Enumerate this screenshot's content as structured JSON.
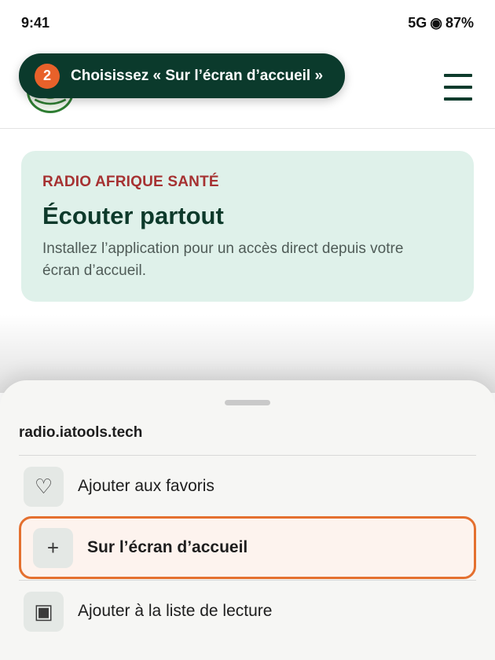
{
  "status_bar": {
    "time": "9:41",
    "network": "5G",
    "signal_glyph": "◉",
    "battery": "87%"
  },
  "header": {
    "logo_icon": "radio-afrique-sante-logo",
    "menu_icon": "hamburger-icon"
  },
  "tooltip": {
    "step_number": "2",
    "text": "Choisissez « Sur l’écran d’accueil »"
  },
  "promo": {
    "eyebrow": "RADIO AFRIQUE SANTÉ",
    "title": "Écouter partout",
    "description": "Installez l’application pour un accès direct depuis votre écran d’accueil."
  },
  "sheet": {
    "url": "radio.iatools.tech",
    "items": [
      {
        "icon": "♡",
        "icon_name": "heart-icon",
        "label": "Ajouter aux favoris"
      },
      {
        "icon": "+",
        "icon_name": "plus-icon",
        "label": "Sur l’écran d’accueil",
        "highlighted": true
      },
      {
        "icon": "▣",
        "icon_name": "reading-list-icon",
        "label": "Ajouter à la liste de lecture"
      }
    ]
  },
  "colors": {
    "brand_dark_green": "#0b3a2c",
    "accent_orange": "#e8612a",
    "eyebrow_red": "#a63232",
    "card_mint": "#dff1ea"
  }
}
